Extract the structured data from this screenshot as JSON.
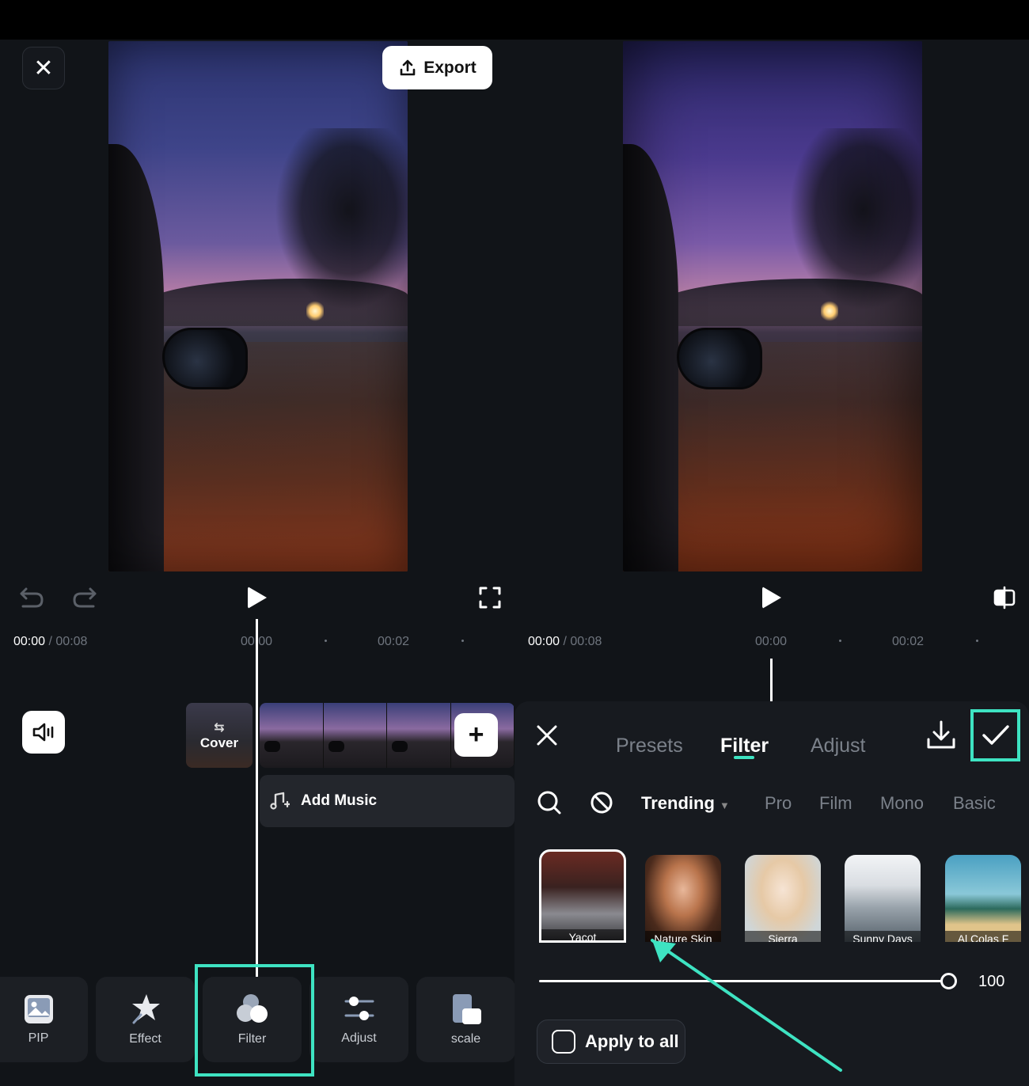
{
  "header": {
    "export_label": "Export"
  },
  "left": {
    "time_current": "00:00",
    "time_total": "/ 00:08",
    "ticks": [
      "00:00",
      "00:02"
    ],
    "cover_label": "Cover",
    "add_music_label": "Add Music",
    "tools": [
      {
        "label": "PIP",
        "icon": "pip-icon"
      },
      {
        "label": "Effect",
        "icon": "effect-icon"
      },
      {
        "label": "Filter",
        "icon": "filter-icon"
      },
      {
        "label": "Adjust",
        "icon": "adjust-icon"
      },
      {
        "label": "scale",
        "icon": "scale-icon"
      }
    ]
  },
  "right": {
    "time_current": "00:00",
    "time_total": "/ 00:08",
    "ticks": [
      "00:00",
      "00:02"
    ],
    "tabs": [
      "Presets",
      "Filter",
      "Adjust"
    ],
    "active_tab": "Filter",
    "categories": [
      "Trending",
      "Pro",
      "Film",
      "Mono",
      "Basic"
    ],
    "active_category": "Trending",
    "filters": [
      "Yacot",
      "Nature Skin",
      "Sierra",
      "Sunny Days",
      "Al Colas F"
    ],
    "intensity": 100,
    "apply_to_all_label": "Apply to all"
  },
  "colors": {
    "accent": "#3ee3c2",
    "background": "#111418"
  }
}
